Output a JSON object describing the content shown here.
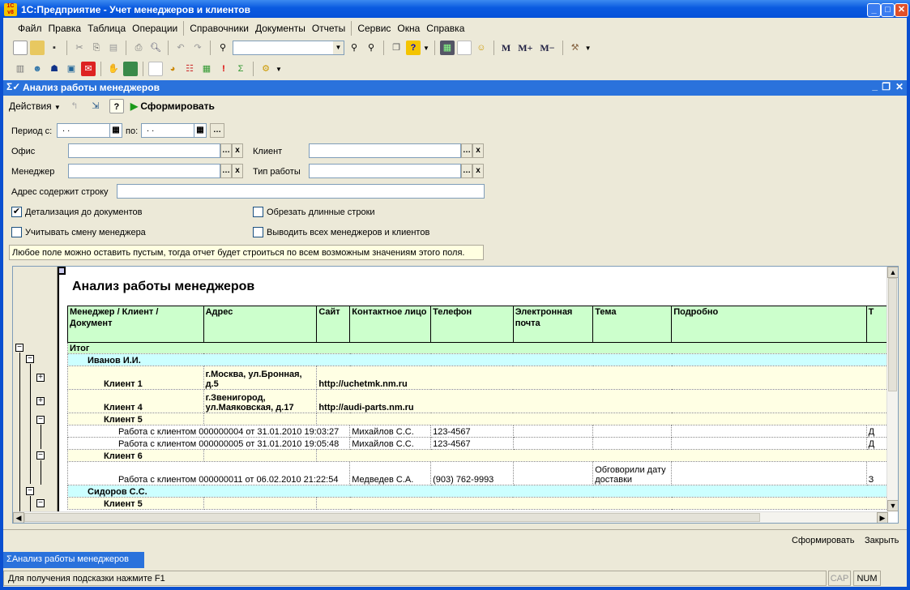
{
  "app": {
    "title": "1С:Предприятие - Учет менеджеров и клиентов",
    "logo": "1С v8"
  },
  "menu": [
    "Файл",
    "Правка",
    "Таблица",
    "Операции",
    "Справочники",
    "Документы",
    "Отчеты",
    "Сервис",
    "Окна",
    "Справка"
  ],
  "toolbar": {
    "search_value": "",
    "memory": [
      "M",
      "M+",
      "M−"
    ]
  },
  "window": {
    "title": "Анализ работы менеджеров"
  },
  "actions": {
    "menu_label": "Действия",
    "generate_label": "Сформировать"
  },
  "form": {
    "period_from_label": "Период с:",
    "period_from_value": ". .",
    "period_to_label": "по:",
    "period_to_value": ". .",
    "office_label": "Офис",
    "office_value": "",
    "client_label": "Клиент",
    "client_value": "",
    "manager_label": "Менеджер",
    "manager_value": "",
    "work_type_label": "Тип работы",
    "work_type_value": "",
    "address_label": "Адрес содержит строку",
    "address_value": "",
    "detail_label": "Детализация до документов",
    "detail_checked": true,
    "trim_label": "Обрезать длинные строки",
    "trim_checked": false,
    "manager_change_label": "Учитывать смену менеджера",
    "manager_change_checked": false,
    "all_label": "Выводить всех менеджеров и клиентов",
    "all_checked": false,
    "hint": "Любое поле можно оставить пустым, тогда отчет будет строиться по всем возможным значениям этого поля."
  },
  "report": {
    "title": "Анализ работы менеджеров",
    "columns": [
      "Менеджер / Клиент / Документ",
      "Адрес",
      "Сайт",
      "Контактное лицо",
      "Телефон",
      "Электронная почта",
      "Тема",
      "Подробно",
      "Т"
    ],
    "rows": [
      {
        "type": "total",
        "name": "Итог"
      },
      {
        "type": "manager",
        "name": "Иванов И.И."
      },
      {
        "type": "client",
        "name": "Клиент 1",
        "address": "г.Москва, ул.Бронная, д.5",
        "site": "http://uchetmk.nm.ru"
      },
      {
        "type": "client",
        "name": "Клиент 4",
        "address": "г.Звенигород, ул.Маяковская, д.17",
        "site": "http://audi-parts.nm.ru"
      },
      {
        "type": "client",
        "name": "Клиент 5",
        "address": "",
        "site": ""
      },
      {
        "type": "doc",
        "document": "Работа с клиентом 000000004 от 31.01.2010 19:03:27",
        "contact": "Михайлов С.С.",
        "phone": "123-4567",
        "email": "",
        "topic": "",
        "details": "",
        "tail": "Д"
      },
      {
        "type": "doc",
        "document": "Работа с клиентом 000000005 от 31.01.2010 19:05:48",
        "contact": "Михайлов С.С.",
        "phone": "123-4567",
        "email": "",
        "topic": "",
        "details": "",
        "tail": "Д"
      },
      {
        "type": "client",
        "name": "Клиент 6",
        "address": "",
        "site": ""
      },
      {
        "type": "doc",
        "document": "Работа с клиентом 000000011 от 06.02.2010 21:22:54",
        "contact": "Медведев С.А.",
        "phone": "(903) 762-9993",
        "email": "",
        "topic": "Обговорили дату доставки",
        "details": "",
        "tail": "З"
      },
      {
        "type": "manager",
        "name": "Сидоров С.С."
      },
      {
        "type": "client",
        "name": "Клиент 5",
        "address": "",
        "site": ""
      }
    ]
  },
  "bottom": {
    "generate_label": "Сформировать",
    "close_label": "Закрыть"
  },
  "taskbar": {
    "tab_label": "Анализ работы менеджеров"
  },
  "status": {
    "text": "Для получения подсказки нажмите F1",
    "cap": "CAP",
    "num": "NUM"
  },
  "colors": {
    "title_blue": "#0a5ae0",
    "header_green": "#ccffcc",
    "manager_cyan": "#ccffff",
    "client_yellow": "#ffffe4"
  }
}
